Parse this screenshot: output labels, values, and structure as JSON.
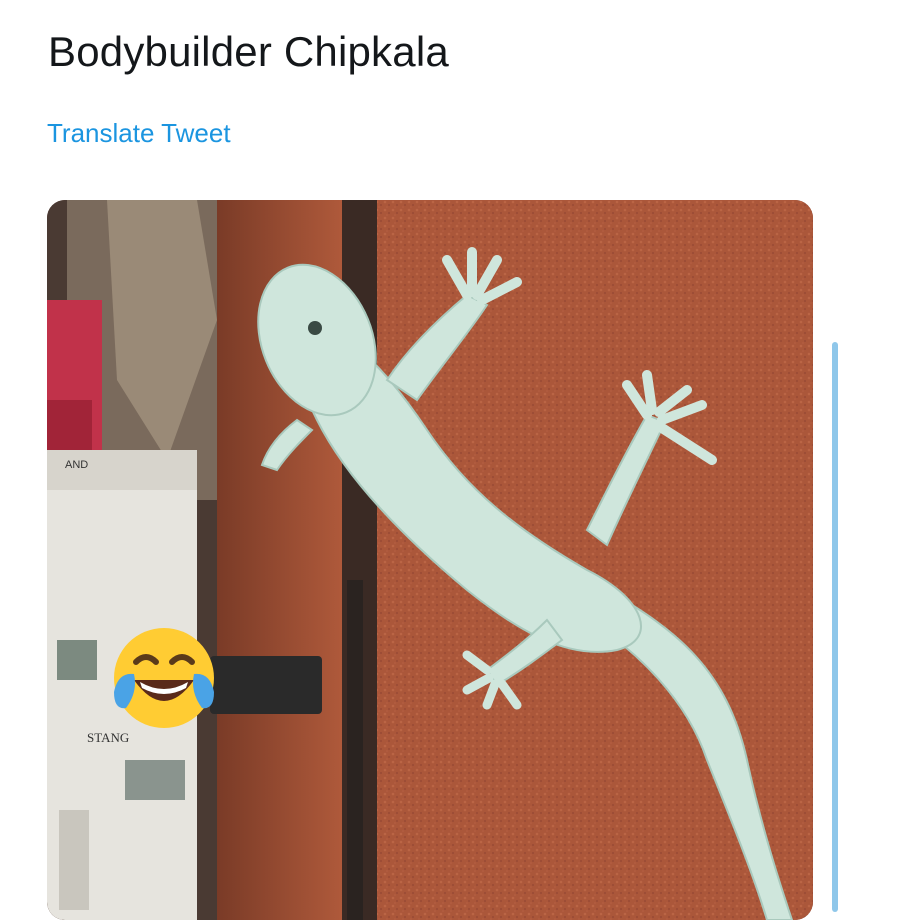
{
  "tweet": {
    "text": "Bodybuilder Chipkala",
    "translate_label": "Translate Tweet"
  },
  "media": {
    "subject": "gecko",
    "box_lines": [
      "AND",
      "STANG"
    ]
  },
  "icons": {
    "reaction": "face-with-tears-of-joy-icon"
  },
  "colors": {
    "link": "#1b95e0",
    "text": "#14171a",
    "thread_line": "#8fc7ea"
  }
}
